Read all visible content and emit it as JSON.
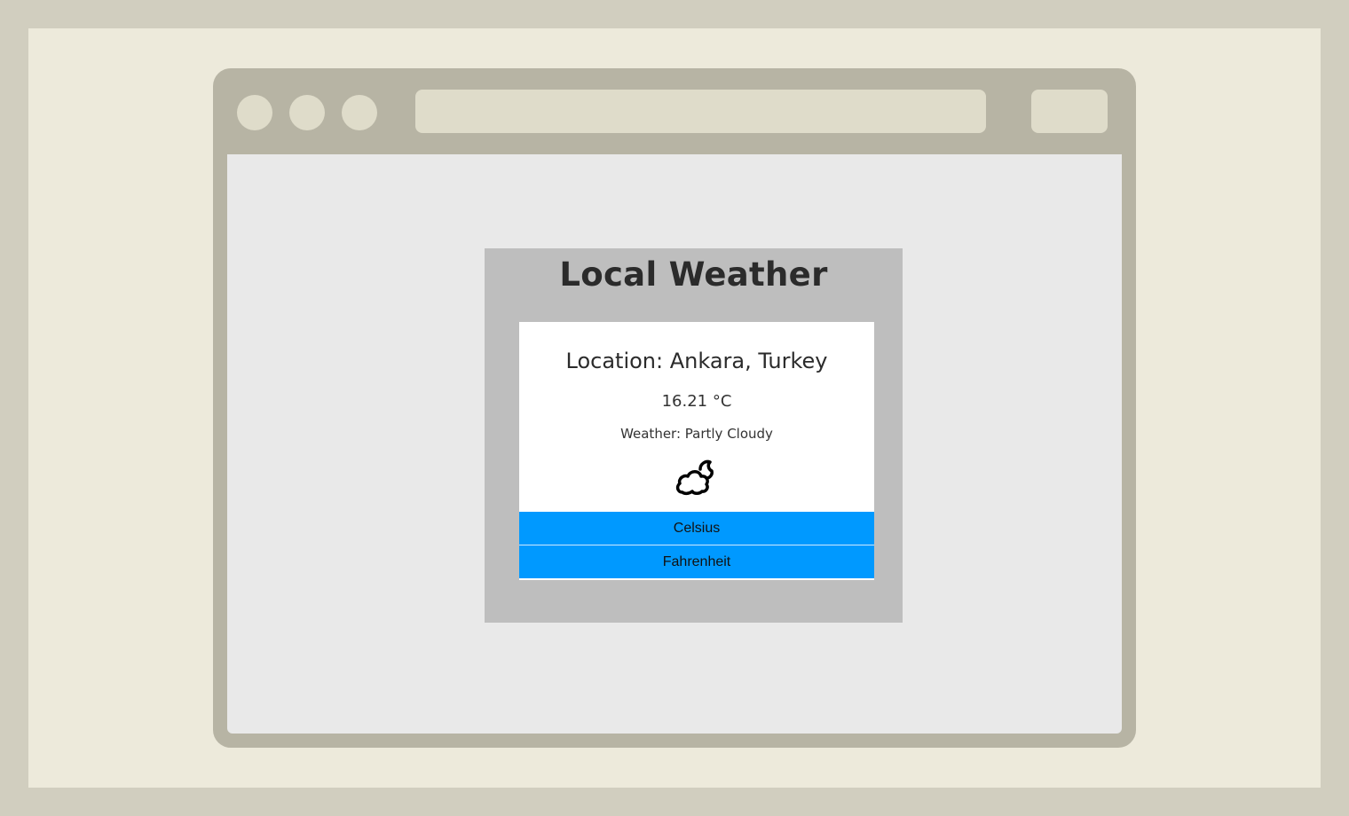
{
  "app": {
    "title": "Local Weather"
  },
  "weather": {
    "location": "Location: Ankara, Turkey",
    "temperature": "16.21 °C",
    "condition": "Weather: Partly Cloudy",
    "icon": "partly-cloudy-icon"
  },
  "buttons": {
    "celsius_label": "Celsius",
    "fahrenheit_label": "Fahrenheit"
  },
  "colors": {
    "button_bg": "#0099ff",
    "panel_bg": "#bebebe",
    "card_bg": "#ffffff",
    "viewport_bg": "#e9e9e9"
  }
}
